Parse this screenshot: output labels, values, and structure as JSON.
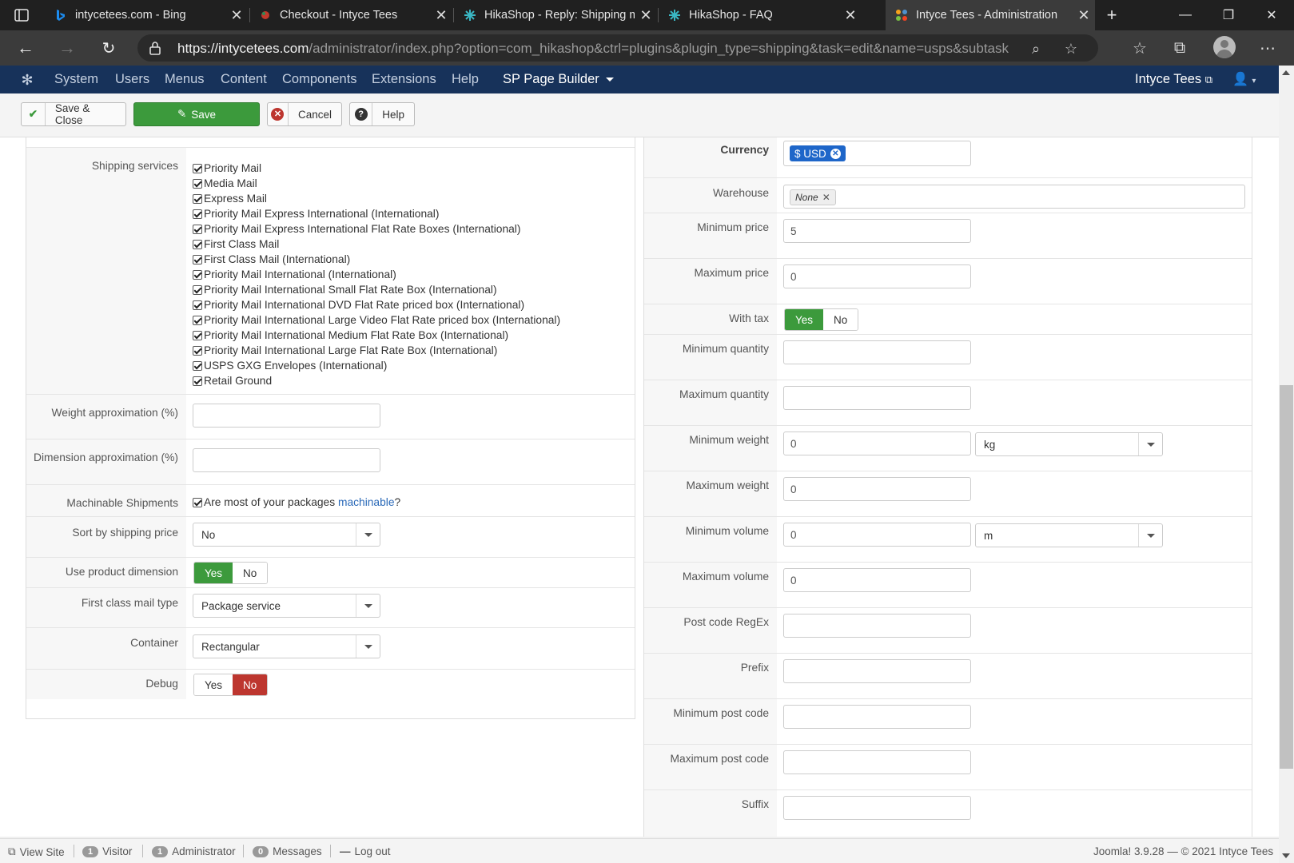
{
  "browser": {
    "tabs": [
      {
        "title": "intycetees.com - Bing",
        "icon": "bing-icon",
        "color": "#1c8cf0"
      },
      {
        "title": "Checkout - Intyce Tees",
        "icon": "site-favicon-icon",
        "color": "#c0392b"
      },
      {
        "title": "HikaShop - Reply: Shipping m",
        "icon": "hikashop-icon",
        "color": "#3ab7c4"
      },
      {
        "title": "HikaShop - FAQ",
        "icon": "hikashop-icon",
        "color": "#3ab7c4"
      },
      {
        "title": "Intyce Tees - Administration",
        "icon": "joomla-icon",
        "color": "#f7a21b",
        "active": true
      }
    ],
    "url_scheme": "https://",
    "url_host": "intycetees.com",
    "url_path": "/administrator/index.php?option=com_hikashop&ctrl=plugins&plugin_type=shipping&task=edit&name=usps&subtask=s..."
  },
  "joomla_nav": {
    "menu": [
      "System",
      "Users",
      "Menus",
      "Content",
      "Components",
      "Extensions",
      "Help"
    ],
    "page_builder": "SP Page Builder",
    "site_name": "Intyce Tees"
  },
  "toolbar": {
    "save_close": "Save & Close",
    "save": "Save",
    "cancel": "Cancel",
    "help": "Help"
  },
  "left": {
    "shipping_services_label": "Shipping services",
    "services": [
      "Priority Mail",
      "Media Mail",
      "Express Mail",
      "Priority Mail Express International (International)",
      "Priority Mail Express International Flat Rate Boxes (International)",
      "First Class Mail",
      "First Class Mail (International)",
      "Priority Mail International (International)",
      "Priority Mail International Small Flat Rate Box (International)",
      "Priority Mail International DVD Flat Rate priced box (International)",
      "Priority Mail International Large Video Flat Rate priced box (International)",
      "Priority Mail International Medium Flat Rate Box (International)",
      "Priority Mail International Large Flat Rate Box (International)",
      "USPS GXG Envelopes (International)",
      "Retail Ground"
    ],
    "weight_approx_label": "Weight approximation (%)",
    "weight_approx_value": "",
    "dimension_approx_label": "Dimension approximation (%)",
    "dimension_approx_value": "",
    "machinable_label": "Machinable Shipments",
    "machinable_text_before": "Are most of your packages ",
    "machinable_link": "machinable",
    "machinable_text_after": "?",
    "sort_label": "Sort by shipping price",
    "sort_value": "No",
    "use_dim_label": "Use product dimension",
    "use_dim_yes": "Yes",
    "use_dim_no": "No",
    "first_class_label": "First class mail type",
    "first_class_value": "Package service",
    "container_label": "Container",
    "container_value": "Rectangular",
    "debug_label": "Debug",
    "debug_yes": "Yes",
    "debug_no": "No"
  },
  "right": {
    "currency_label": "Currency",
    "currency_tag": "$ USD",
    "warehouse_label": "Warehouse",
    "warehouse_tag": "None",
    "min_price_label": "Minimum price",
    "min_price_value": "5",
    "max_price_label": "Maximum price",
    "max_price_value": "0",
    "with_tax_label": "With tax",
    "with_tax_yes": "Yes",
    "with_tax_no": "No",
    "min_qty_label": "Minimum quantity",
    "min_qty_value": "",
    "max_qty_label": "Maximum quantity",
    "max_qty_value": "",
    "min_weight_label": "Minimum weight",
    "min_weight_value": "0",
    "weight_unit": "kg",
    "max_weight_label": "Maximum weight",
    "max_weight_value": "0",
    "min_volume_label": "Minimum volume",
    "min_volume_value": "0",
    "volume_unit": "m",
    "max_volume_label": "Maximum volume",
    "max_volume_value": "0",
    "postcode_regex_label": "Post code RegEx",
    "prefix_label": "Prefix",
    "min_postcode_label": "Minimum post code",
    "max_postcode_label": "Maximum post code",
    "suffix_label": "Suffix"
  },
  "statusbar": {
    "view_site": "View Site",
    "visitor_count": "1",
    "visitor_label": "Visitor",
    "admin_count": "1",
    "admin_label": "Administrator",
    "messages_count": "0",
    "messages_label": "Messages",
    "logout": "Log out",
    "version": "Joomla! 3.9.28",
    "dash": "—",
    "copyright": "© 2021 Intyce Tees"
  },
  "colors": {
    "nav_bg": "#17325a",
    "save_green": "#3c9a3c",
    "debug_red": "#bd362f",
    "tag_blue": "#1e66c9"
  }
}
